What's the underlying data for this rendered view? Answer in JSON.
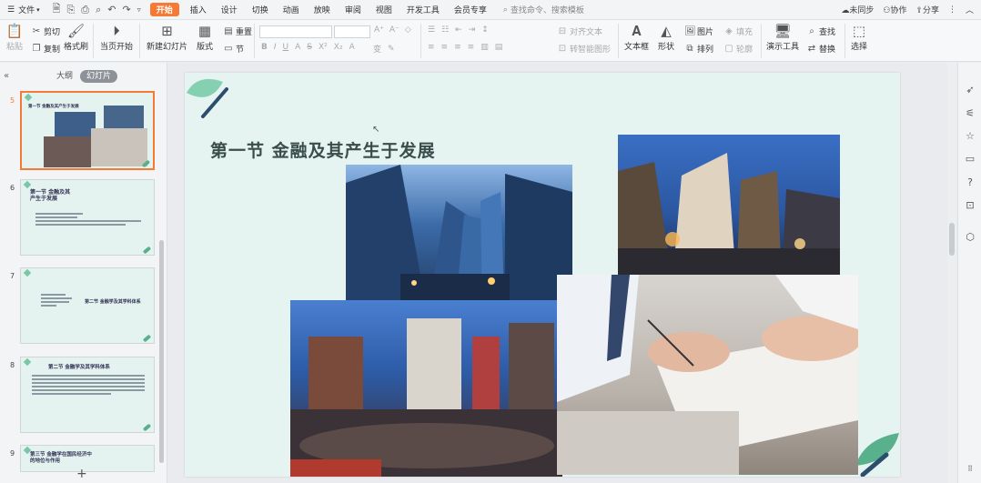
{
  "menubar": {
    "file": "文件",
    "tabs": [
      "开始",
      "插入",
      "设计",
      "切换",
      "动画",
      "放映",
      "审阅",
      "视图",
      "开发工具",
      "会员专享"
    ],
    "search_placeholder": "查找命令、搜索模板",
    "sync": "未同步",
    "collab": "协作",
    "share": "分享"
  },
  "ribbon": {
    "paste": "粘贴",
    "cut": "剪切",
    "copy": "复制",
    "format_painter": "格式刷",
    "from_start": "当页开始",
    "new_slide": "新建幻灯片",
    "layout": "版式",
    "reset": "重置",
    "section": "节",
    "align_text": "对齐文本",
    "convert_smartart": "转智能图形",
    "textbox": "文本框",
    "shape": "形状",
    "picture": "图片",
    "fill": "填充",
    "arrange": "排列",
    "outline": "轮廓",
    "present_tool": "演示工具",
    "find": "查找",
    "replace": "替换",
    "select": "选择"
  },
  "leftpanel": {
    "tab_outline": "大纲",
    "tab_slides": "幻灯片",
    "thumbs": [
      {
        "num": "5",
        "title": "第一节  金融及其产生于发展"
      },
      {
        "num": "6",
        "title": "第一节  金融及其产生于发展"
      },
      {
        "num": "7",
        "title": "第二节  金融学及其学科体系"
      },
      {
        "num": "8",
        "title": "第二节  金融学及其学科体系"
      },
      {
        "num": "9",
        "title": "第三节  金融学在国民经济中的地位与作用"
      }
    ],
    "add": "+"
  },
  "slide": {
    "title": "第一节  金融及其产生于发展"
  },
  "colors": {
    "accent": "#f47a36",
    "slide_bg": "#e5f4f0",
    "title_color": "#3a4d4a",
    "leaf_green": "#6cc3a0",
    "leaf_dark": "#2d4d6e"
  },
  "icons": {
    "paste": "clipboard-icon",
    "cut": "scissors-icon",
    "play": "play-icon",
    "search": "search-icon"
  }
}
